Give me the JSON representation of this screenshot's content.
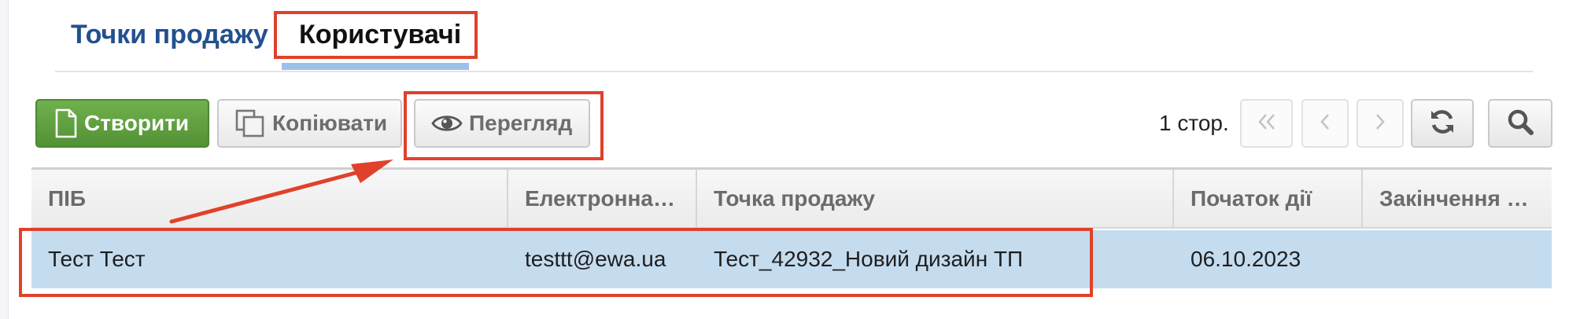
{
  "tabs": [
    {
      "label": "Точки продажу"
    },
    {
      "label": "Користувачі",
      "active": true
    }
  ],
  "toolbar": {
    "create_label": "Створити",
    "copy_label": "Копіювати",
    "view_label": "Перегляд"
  },
  "pager": {
    "page_info": "1 стор."
  },
  "table": {
    "columns": [
      "ПІБ",
      "Електронна…",
      "Точка продажу",
      "Початок дії",
      "Закінчення …"
    ],
    "rows": [
      {
        "name": "Тест Тест",
        "email": "testtt@ewa.ua",
        "point": "Тест_42932_Новий дизайн ТП",
        "start": "06.10.2023",
        "end": "",
        "selected": true
      }
    ]
  },
  "colors": {
    "accent": "#23508e",
    "create_button": "#5fa03f",
    "selected_row": "#c5dcef",
    "annotation": "#e0412a"
  },
  "icons": {
    "create": "document-icon",
    "copy": "copy-icon",
    "view": "eye-icon",
    "first": "double-chevron-left-icon",
    "prev": "chevron-left-icon",
    "next": "chevron-right-icon",
    "refresh": "refresh-icon",
    "search": "search-icon"
  }
}
